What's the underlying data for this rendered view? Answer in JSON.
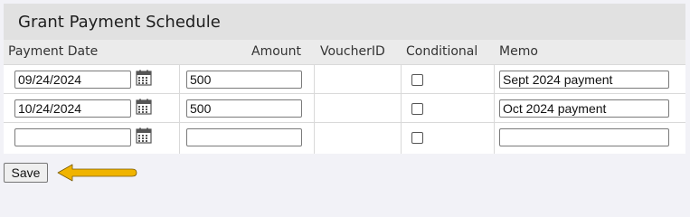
{
  "title": "Grant Payment Schedule",
  "columns": {
    "payment_date": "Payment Date",
    "amount": "Amount",
    "voucher_id": "VoucherID",
    "conditional": "Conditional",
    "memo": "Memo"
  },
  "rows": [
    {
      "payment_date": "09/24/2024",
      "amount": "500",
      "voucher_id": "",
      "conditional": false,
      "memo": "Sept 2024 payment"
    },
    {
      "payment_date": "10/24/2024",
      "amount": "500",
      "voucher_id": "",
      "conditional": false,
      "memo": "Oct 2024 payment"
    },
    {
      "payment_date": "",
      "amount": "",
      "voucher_id": "",
      "conditional": false,
      "memo": ""
    }
  ],
  "save_label": "Save",
  "icons": {
    "calendar": "calendar-icon",
    "annotation": "arrow-left-icon"
  },
  "colors": {
    "arrow": "#f0b400",
    "header_bg": "#ebebeb",
    "title_bg": "#e1e1e1"
  }
}
